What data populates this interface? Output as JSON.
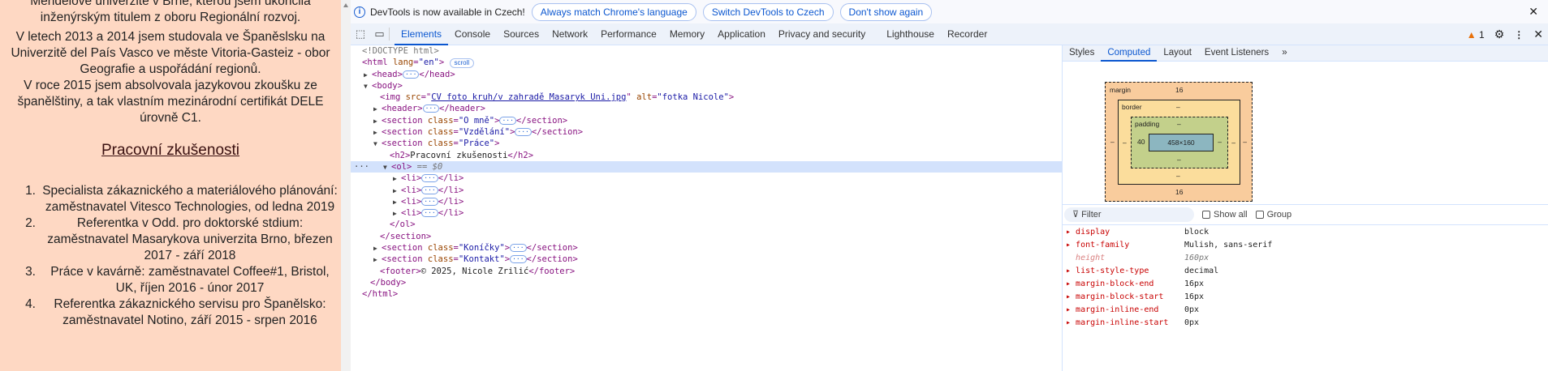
{
  "page": {
    "paragraphs": [
      "Mendelově univerzitě v Brně, kterou jsem ukončila inženýrským titulem z oboru Regionální rozvoj.",
      "V letech 2013 a 2014 jsem studovala ve Španěslsku na Univerzitě del País Vasco ve měste Vitoria-Gasteiz - obor Geografie a uspořádání regionů.",
      "V roce 2015 jsem absolvovala jazykovou zkoušku ze španělštiny, a tak vlastním mezinárodní certifikát DELE úrovně C1."
    ],
    "heading": "Pracovní zkušenosti",
    "jobs": [
      {
        "n": "1.",
        "t": "Specialista zákaznického a materiálového plánování: zaměstnavatel Vitesco Technologies, od ledna 2019"
      },
      {
        "n": "2.",
        "t": "Referentka v Odd. pro doktorské stdium: zaměstnavatel Masarykova univerzita Brno, březen 2017 - září 2018"
      },
      {
        "n": "3.",
        "t": "Práce v kavárně: zaměstnavatel Coffee#1, Bristol, UK, říjen 2016 - únor 2017"
      },
      {
        "n": "4.",
        "t": "Referentka zákaznického servisu pro Španělsko: zaměstnavatel Notino, září 2015 - srpen 2016"
      }
    ]
  },
  "infobar": {
    "message": "DevTools is now available in Czech!",
    "buttons": [
      "Always match Chrome's language",
      "Switch DevTools to Czech",
      "Don't show again"
    ],
    "close": "✕"
  },
  "tabs": [
    "Elements",
    "Console",
    "Sources",
    "Network",
    "Performance",
    "Memory",
    "Application",
    "Privacy and security",
    "Lighthouse",
    "Recorder"
  ],
  "issues_count": "1",
  "tree": {
    "doctype": "<!DOCTYPE html>",
    "scroll_badge": "scroll",
    "img_src": "CV foto kruh/v zahradě Masaryk Uni.jpg",
    "img_alt": "fotka Nicole",
    "class_o_mne": "O mně",
    "class_vzdelani": "Vzdělání",
    "class_prace": "Práce",
    "h2": "Pracovní zkušenosti",
    "sel_marker": "== $0",
    "class_konicky": "Koníčky",
    "class_kontakt": "Kontakt",
    "footer": "© 2025, Nicole Zrilić"
  },
  "sidebar": {
    "tabs": [
      "Styles",
      "Computed",
      "Layout",
      "Event Listeners"
    ],
    "box": {
      "margin_label": "margin",
      "border_label": "border",
      "padding_label": "padding",
      "margin_top": "16",
      "margin_bottom": "16",
      "margin_side": "–",
      "border_val": "–",
      "padding_top": "–",
      "padding_bottom": "–",
      "padding_left": "40",
      "padding_right": "–",
      "content": "458×160"
    },
    "filter_placeholder": "Filter",
    "show_all": "Show all",
    "group": "Group",
    "props": [
      {
        "k": "display",
        "v": "block"
      },
      {
        "k": "font-family",
        "v": "Mulish, sans-serif"
      },
      {
        "k": "height",
        "v": "160px",
        "inherited": true
      },
      {
        "k": "list-style-type",
        "v": "decimal"
      },
      {
        "k": "margin-block-end",
        "v": "16px"
      },
      {
        "k": "margin-block-start",
        "v": "16px"
      },
      {
        "k": "margin-inline-end",
        "v": "0px"
      },
      {
        "k": "margin-inline-start",
        "v": "0px"
      }
    ]
  }
}
